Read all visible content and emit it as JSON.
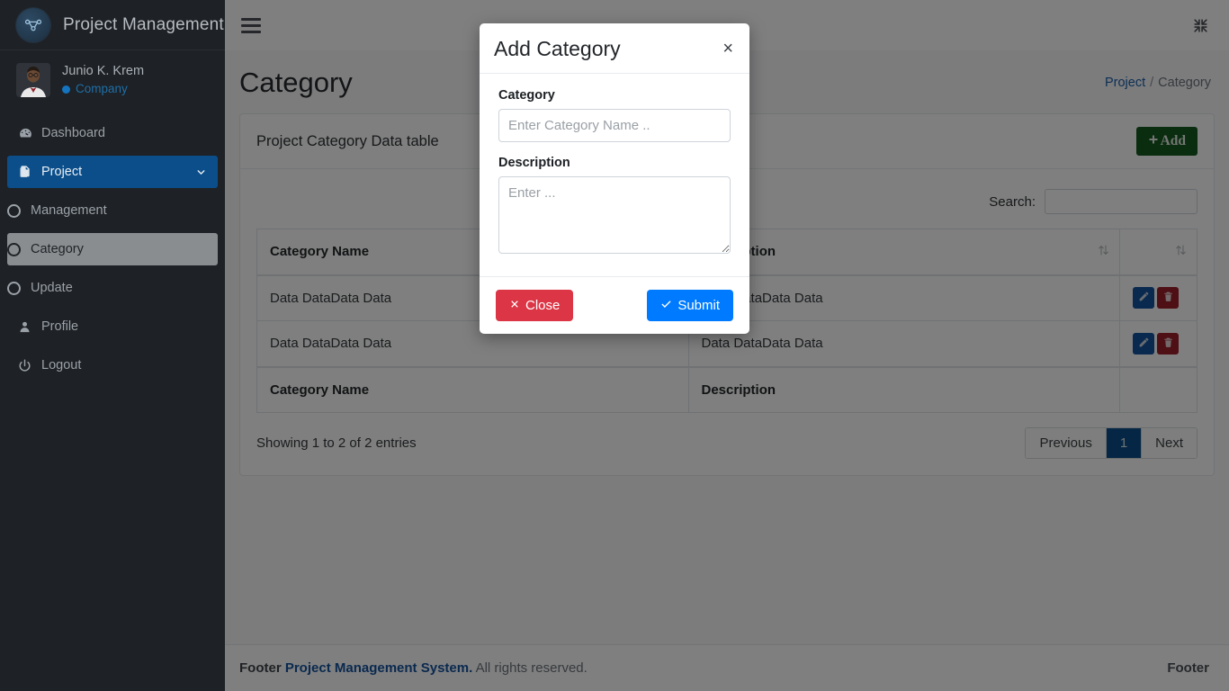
{
  "sidebar": {
    "brand": {
      "title": "Project Management",
      "logo_icon": "network-nodes-icon"
    },
    "profile": {
      "name": "Junio K. Krem",
      "role": "Company",
      "status_color": "#1574bf",
      "avatar_icon": "user-avatar"
    },
    "items": [
      {
        "label": "Dashboard",
        "icon": "speedometer-icon",
        "state": "default",
        "sub": false
      },
      {
        "label": "Project",
        "icon": "file-copy-icon",
        "state": "active-blue",
        "sub": false,
        "caret": "chevron-down-icon"
      },
      {
        "label": "Management",
        "icon": "circle-icon",
        "state": "default",
        "sub": true
      },
      {
        "label": "Category",
        "icon": "circle-icon",
        "state": "active-grey",
        "sub": true
      },
      {
        "label": "Update",
        "icon": "circle-icon",
        "state": "default",
        "sub": true
      },
      {
        "label": "Profile",
        "icon": "person-icon",
        "state": "default",
        "sub": false
      },
      {
        "label": "Logout",
        "icon": "power-icon",
        "state": "default",
        "sub": false
      }
    ]
  },
  "topbar": {
    "menu_toggle_icon": "hamburger-icon",
    "fullscreen_toggle_icon": "compress-arrows-icon"
  },
  "page": {
    "title": "Category",
    "breadcrumb": {
      "parent": "Project",
      "separator": "/",
      "current": "Category"
    }
  },
  "card": {
    "title": "Project Category Data table",
    "add_button": {
      "label": "Add",
      "icon": "plus-icon",
      "color": "#14591f"
    }
  },
  "datatable": {
    "search_label": "Search:",
    "search_value": "",
    "search_placeholder": "",
    "columns": [
      "Category Name",
      "Description",
      ""
    ],
    "sort_icon": "sort-updown-icon",
    "rows": [
      {
        "name": "Data DataData Data",
        "description": "Data DataData Data",
        "actions": [
          {
            "name": "edit-button",
            "icon": "pencil-icon",
            "color": "#14539f"
          },
          {
            "name": "delete-button",
            "icon": "trash-icon",
            "color": "#9c1f2b"
          }
        ]
      },
      {
        "name": "Data DataData Data",
        "description": "Data DataData Data",
        "actions": [
          {
            "name": "edit-button",
            "icon": "pencil-icon",
            "color": "#14539f"
          },
          {
            "name": "delete-button",
            "icon": "trash-icon",
            "color": "#9c1f2b"
          }
        ]
      }
    ],
    "footer_columns": [
      "Category Name",
      "Description",
      ""
    ],
    "info": "Showing 1 to 2 of 2 entries",
    "pagination": {
      "previous": "Previous",
      "pages": [
        "1"
      ],
      "next": "Next",
      "active": "1",
      "active_color": "#0b4e8a"
    }
  },
  "modal": {
    "title": "Add Category",
    "close_icon": "times-icon",
    "fields": {
      "category": {
        "label": "Category",
        "value": "",
        "placeholder": "Enter Category Name .."
      },
      "description": {
        "label": "Description",
        "value": "",
        "placeholder": "Enter ..."
      }
    },
    "buttons": {
      "close": {
        "label": "Close",
        "icon": "times-mark-icon",
        "color": "#dc3545"
      },
      "submit": {
        "label": "Submit",
        "icon": "check-icon",
        "color": "#007bff"
      }
    }
  },
  "footer": {
    "left_prefix": "Footer",
    "left_link": "Project Management System.",
    "left_suffix": "All rights reserved.",
    "right": "Footer"
  }
}
